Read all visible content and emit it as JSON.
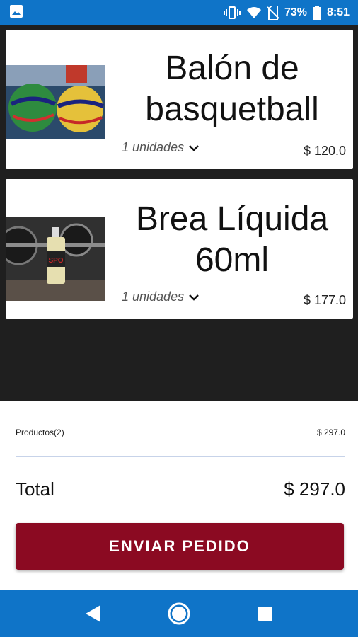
{
  "status_bar": {
    "battery": "73%",
    "time": "8:51"
  },
  "cart": {
    "items": [
      {
        "name": "Balón de basquetball",
        "quantity": "1 unidades",
        "price": "$ 120.0",
        "image": "basketballs-image"
      },
      {
        "name": "Brea Líquida 60ml",
        "quantity": "1 unidades",
        "price": "$ 177.0",
        "image": "liquid-resin-bottle-image"
      }
    ]
  },
  "summary": {
    "products_label": "Productos(2)",
    "products_amount": "$ 297.0",
    "total_label": "Total",
    "total_amount": "$ 297.0",
    "send_button": "ENVIAR PEDIDO"
  },
  "colors": {
    "status_bar": "#0f74c8",
    "send_button": "#8b0a22",
    "background": "#1f1f1f"
  }
}
